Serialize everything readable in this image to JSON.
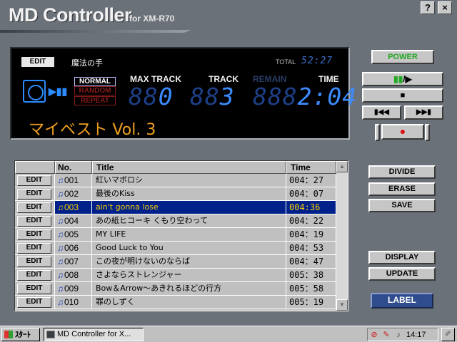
{
  "window": {
    "title_main": "MD Controller",
    "title_sub": "for XM-R70",
    "help_label": "?",
    "close_label": "×"
  },
  "lcd": {
    "edit_label": "EDIT",
    "disc_title": "魔法の手",
    "total_label": "TOTAL",
    "total_value": "52:27",
    "mode_normal": "NORMAL",
    "mode_random": "RANDOM",
    "mode_repeat": "REPEAT",
    "label_maxtrack": "MAX TRACK",
    "label_track": "TRACK",
    "label_remain": "REMAIN",
    "label_time": "TIME",
    "maxtrack_dim": "88",
    "maxtrack_on": "0",
    "track_dim": "88",
    "track_on": "3",
    "time_dim": "888",
    "time_on": "2:04",
    "disc_name": "マイベスト Vol. 3",
    "play_pause_icon": "▶▮▮"
  },
  "controls": {
    "power": "POWER",
    "pause_glyph": "▮▮",
    "play_glyph": "/▶",
    "stop": "■",
    "rewind": "▮◀◀",
    "fast_forward": "▶▶▮",
    "record": "●"
  },
  "tracklist": {
    "headers": {
      "no": "No.",
      "title": "Title",
      "time": "Time"
    },
    "edit_label": "EDIT",
    "note_icon": "♫",
    "rows": [
      {
        "no": "001",
        "title": "紅いマボロシ",
        "time": "004：27",
        "selected": false
      },
      {
        "no": "002",
        "title": "最後のKiss",
        "time": "004：07",
        "selected": false
      },
      {
        "no": "003",
        "title": "ain't gonna lose",
        "time": "004:36",
        "selected": true
      },
      {
        "no": "004",
        "title": "あの紙ヒコーキ くもり空わって",
        "time": "004：22",
        "selected": false
      },
      {
        "no": "005",
        "title": "MY LIFE",
        "time": "004：19",
        "selected": false
      },
      {
        "no": "006",
        "title": "Good Luck to You",
        "time": "004：53",
        "selected": false
      },
      {
        "no": "007",
        "title": "この夜が明けないのならば",
        "time": "004：47",
        "selected": false
      },
      {
        "no": "008",
        "title": "さよならストレンジャー",
        "time": "005：38",
        "selected": false
      },
      {
        "no": "009",
        "title": "Bow＆Arrow〜あきれるほどの行方",
        "time": "005：58",
        "selected": false
      },
      {
        "no": "010",
        "title": "罪のしずく",
        "time": "005：19",
        "selected": false
      }
    ],
    "scroll_up": "▲",
    "scroll_down": "▼"
  },
  "actions": {
    "divide": "DIVIDE",
    "erase": "ERASE",
    "save": "SAVE",
    "display": "DISPLAY",
    "update": "UPDATE",
    "label": "LABEL"
  },
  "taskbar": {
    "start_label": "ｽﾀｰﾄ",
    "task_label": "MD Controller for X...",
    "clock": "14:17",
    "tray_forbid": "⊘",
    "tray_net": "✎",
    "tray_speaker": "♪",
    "desk_icon": "✐"
  }
}
